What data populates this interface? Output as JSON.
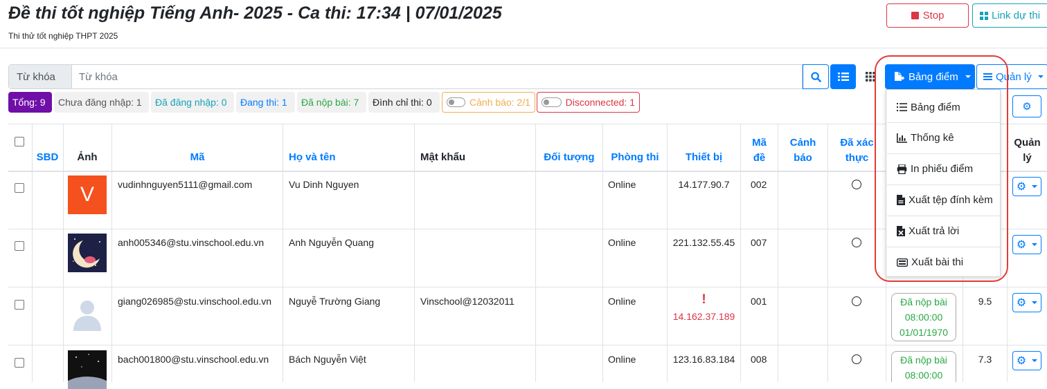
{
  "header": {
    "title": "Đề thi tốt nghiệp Tiếng Anh- 2025 - Ca thi: 17:34 | 07/01/2025",
    "subtitle": "Thi thử tốt nghiệp THPT 2025",
    "stop_label": "Stop",
    "link_label": "Link dự thi"
  },
  "search": {
    "addon": "Từ khóa",
    "placeholder": "Từ khóa"
  },
  "toolbar": {
    "bangdiem_label": "Bảng điểm",
    "quanly_label": "Quản lý"
  },
  "badges": {
    "tong": "Tổng: 9",
    "chua_dang_nhap": "Chưa đăng nhập: 1",
    "da_dang_nhap": "Đã đăng nhập: 0",
    "dang_thi": "Đang thi: 1",
    "da_nop_bai": "Đã nộp bài: 7",
    "dinh_chi_thi": "Đình chỉ thi: 0",
    "canh_bao": "Cảnh báo: 2/1",
    "disconnected": "Disconnected: 1"
  },
  "colors": {
    "primary": "#007bff",
    "danger": "#dc3545",
    "success": "#28a745",
    "info": "#17a2b8",
    "warning": "#f0ad4e",
    "tong_badge": "#6f0fa8"
  },
  "table": {
    "headers": {
      "sbd": "SBD",
      "anh": "Ảnh",
      "ma": "Mã",
      "ho_va_ten": "Họ và tên",
      "mat_khau": "Mật khẩu",
      "doi_tuong": "Đối tượng",
      "phong_thi": "Phòng thi",
      "thiet_bi": "Thiết bị",
      "ma_de_1": "Mã",
      "ma_de_2": "đề",
      "canh_bao_1": "Cảnh",
      "canh_bao_2": "báo",
      "da_xac_thuc_1": "Đã xác",
      "da_xac_thuc_2": "thực",
      "quan_ly_1": "Quản",
      "quan_ly_2": "lý"
    },
    "rows": [
      {
        "ma": "vudinhnguyen5111@gmail.com",
        "ho_ten": "Vu Dinh Nguyen",
        "mat_khau": "",
        "phong_thi": "Online",
        "thiet_bi": "14.177.90.7",
        "ma_de": "002",
        "avatar_letter": "V"
      },
      {
        "ma": "anh005346@stu.vinschool.edu.vn",
        "ho_ten": "Anh Nguyễn Quang",
        "mat_khau": "",
        "phong_thi": "Online",
        "thiet_bi": "221.132.55.45",
        "ma_de": "007"
      },
      {
        "ma": "giang026985@stu.vinschool.edu.vn",
        "ho_ten": "Nguyễ Trường Giang",
        "mat_khau": "Vinschool@12032011",
        "phong_thi": "Online",
        "thiet_bi_warning": "!",
        "thiet_bi": "14.162.37.189",
        "ma_de": "001",
        "status_1": "Đã nộp bài",
        "status_2": "08:00:00",
        "status_3": "01/01/1970",
        "diem": "9.5"
      },
      {
        "ma": "bach001800@stu.vinschool.edu.vn",
        "ho_ten": "Bách Nguyễn Việt",
        "mat_khau": "",
        "phong_thi": "Online",
        "thiet_bi": "123.16.83.184",
        "ma_de": "008",
        "status_1": "Đã nộp bài",
        "status_2": "08:00:00",
        "diem": "7.3"
      }
    ]
  },
  "dropdown": {
    "items": [
      {
        "label": "Bảng điểm",
        "icon": "list-ol-icon"
      },
      {
        "label": "Thống kê",
        "icon": "bar-chart-icon"
      },
      {
        "label": "In phiếu điểm",
        "icon": "printer-icon"
      },
      {
        "label": "Xuất tệp đính kèm",
        "icon": "file-pdf-icon"
      },
      {
        "label": "Xuất trả lời",
        "icon": "file-excel-icon"
      },
      {
        "label": "Xuất bài thi",
        "icon": "keyboard-icon"
      }
    ]
  }
}
